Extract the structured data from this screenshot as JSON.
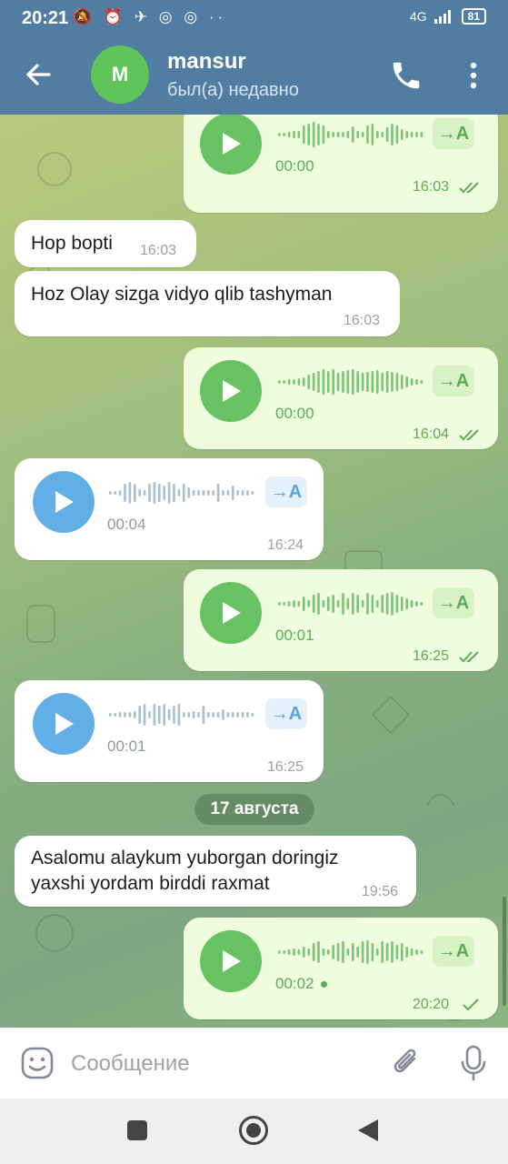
{
  "status_bar": {
    "time": "20:21",
    "icons": "🔕 ⏰ ✈ ◎ ◎ ··",
    "network": "4G",
    "battery": "81"
  },
  "header": {
    "avatar_initial": "M",
    "contact_name": "mansur",
    "contact_status": "был(а) недавно",
    "icons": [
      "back-arrow-icon",
      "phone-icon",
      "more-vertical-icon"
    ]
  },
  "messages": [
    {
      "type": "voice",
      "direction": "out",
      "duration": "00:00",
      "time": "16:03",
      "status": "read",
      "transcribe_label": "→A"
    },
    {
      "type": "text",
      "direction": "in",
      "text": "Hop bopti",
      "time": "16:03"
    },
    {
      "type": "text",
      "direction": "in",
      "text": "Hoz Olay sizga vidyo qlib tashyman",
      "time": "16:03"
    },
    {
      "type": "voice",
      "direction": "out",
      "duration": "00:00",
      "time": "16:04",
      "status": "read",
      "transcribe_label": "→A"
    },
    {
      "type": "voice",
      "direction": "in",
      "duration": "00:04",
      "time": "16:24",
      "transcribe_label": "→A"
    },
    {
      "type": "voice",
      "direction": "out",
      "duration": "00:01",
      "time": "16:25",
      "status": "read",
      "transcribe_label": "→A"
    },
    {
      "type": "voice",
      "direction": "in",
      "duration": "00:01",
      "time": "16:25",
      "transcribe_label": "→A"
    },
    {
      "type": "text",
      "direction": "in",
      "text_line1": "Asalomu alaykum yuborgan doringiz",
      "text_line2": "yaxshi yordam birddi raxmat",
      "time": "19:56"
    },
    {
      "type": "voice",
      "direction": "out",
      "duration": "00:02",
      "time": "20:20",
      "status": "sent",
      "transcribe_label": "→A"
    }
  ],
  "date_separator": "17 августа",
  "input": {
    "placeholder": "Сообщение",
    "icons": [
      "emoji-icon",
      "paperclip-icon",
      "microphone-icon"
    ]
  },
  "colors": {
    "header": "#527da3",
    "outgoing_bubble": "#effdde",
    "incoming_bubble": "#ffffff",
    "outgoing_accent": "#68c163",
    "incoming_accent": "#62aee6"
  }
}
